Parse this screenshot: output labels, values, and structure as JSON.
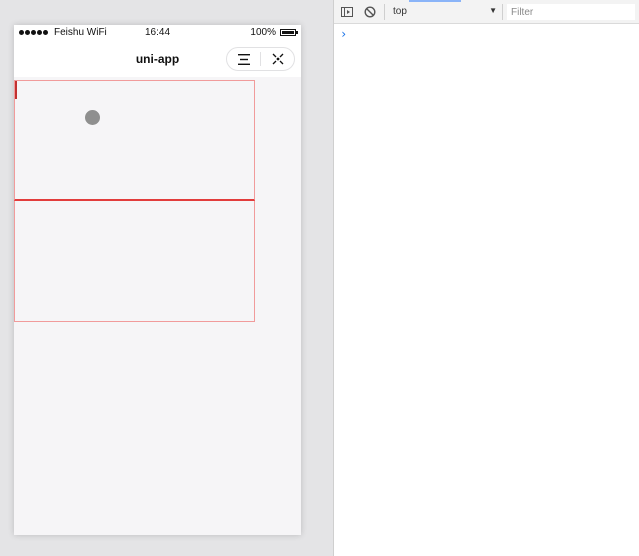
{
  "status_bar": {
    "carrier": "Feishu WiFi",
    "time": "16:44",
    "battery": "100%"
  },
  "nav_bar": {
    "title": "uni-app",
    "menu_icon": "menu-icon",
    "close_icon": "close-target-icon"
  },
  "colors": {
    "box_border": "#f19b9b",
    "box_divider": "#e23c3c",
    "dot": "#8f8f8f",
    "page_bg": "#f6f5f7"
  },
  "devtools": {
    "context": "top",
    "filter_placeholder": "Filter",
    "prompt": "›"
  }
}
